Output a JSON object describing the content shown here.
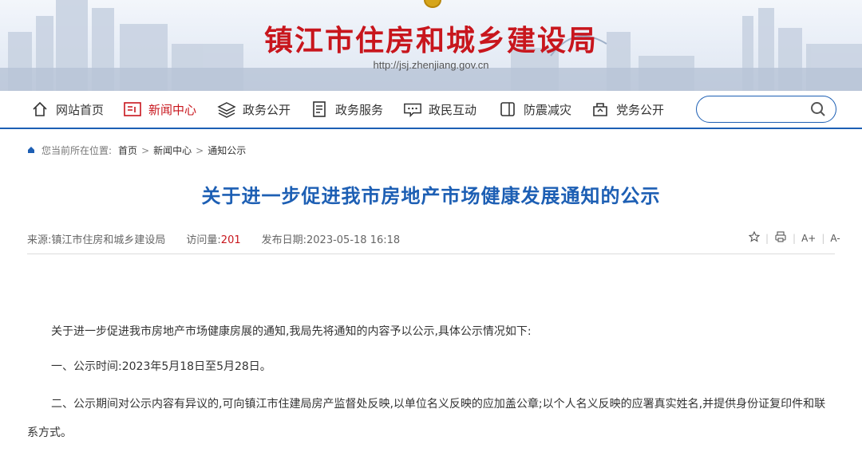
{
  "header": {
    "site_title": "镇江市住房和城乡建设局",
    "site_url": "http://jsj.zhenjiang.gov.cn"
  },
  "nav": {
    "items": [
      {
        "label": "网站首页",
        "icon": "home-icon"
      },
      {
        "label": "新闻中心",
        "icon": "news-icon",
        "active": true
      },
      {
        "label": "政务公开",
        "icon": "layers-icon"
      },
      {
        "label": "政务服务",
        "icon": "document-icon"
      },
      {
        "label": "政民互动",
        "icon": "chat-icon"
      },
      {
        "label": "防震减灾",
        "icon": "window-icon"
      },
      {
        "label": "党务公开",
        "icon": "party-icon"
      }
    ],
    "search_placeholder": ""
  },
  "breadcrumb": {
    "lead": "您当前所在位置:",
    "items": [
      "首页",
      "新闻中心",
      "通知公示"
    ]
  },
  "article": {
    "title": "关于进一步促进我市房地产市场健康发展通知的公示",
    "source_label": "来源:",
    "source": "镇江市住房和城乡建设局",
    "views_label": "访问量:",
    "views": "201",
    "date_label": "发布日期:",
    "date": "2023-05-18 16:18",
    "tools": [
      "star-icon",
      "print-icon",
      "A+",
      "A-"
    ],
    "paragraphs": [
      "关于进一步促进我市房地产市场健康房展的通知,我局先将通知的内容予以公示,具体公示情况如下:",
      "一、公示时间:2023年5月18日至5月28日。",
      "二、公示期间对公示内容有异议的,可向镇江市住建局房产监督处反映,以单位名义反映的应加盖公章;以个人名义反映的应署真实姓名,并提供身份证复印件和联系方式。"
    ]
  },
  "colors": {
    "brand_red": "#c8161d",
    "brand_blue": "#1d5fb4"
  }
}
